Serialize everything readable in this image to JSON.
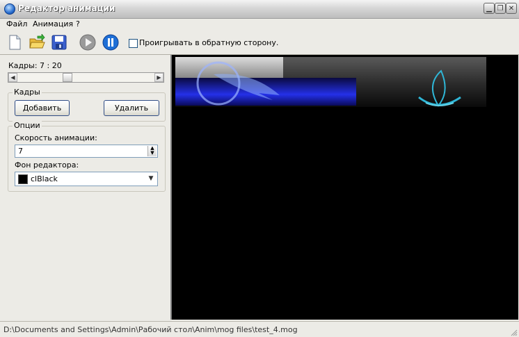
{
  "window": {
    "title": "Редактор анимации"
  },
  "menu": {
    "items": [
      "Файл",
      "Анимация",
      "?"
    ]
  },
  "toolbar": {
    "reverse_label": "Проигрывать в обратную сторону."
  },
  "frames": {
    "counter": "Кадры: 7 : 20",
    "group_title": "Кадры",
    "add_label": "Добавить",
    "delete_label": "Удалить",
    "slider_value": 0.35
  },
  "options": {
    "group_title": "Опции",
    "speed_label": "Скорость анимации:",
    "speed_value": "7",
    "bg_label": "Фон редактора:",
    "bg_value": "clBlack",
    "bg_color": "#000000"
  },
  "status": {
    "path": "D:\\Documents and Settings\\Admin\\Рабочий стол\\Anim\\mog files\\test_4.mog"
  }
}
